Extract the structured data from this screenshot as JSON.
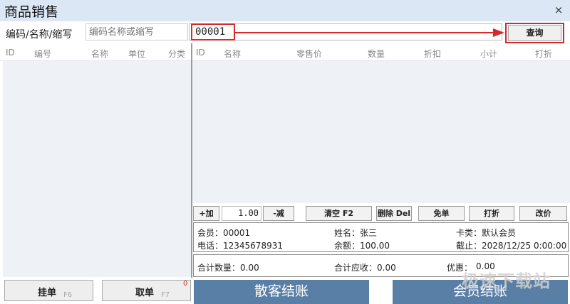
{
  "window": {
    "title": "商品销售",
    "close_glyph": "×"
  },
  "search": {
    "label": "编码/名称/缩写",
    "placeholder": "编码名称或缩写",
    "code_value": "00001",
    "query_label": "查询"
  },
  "product_table": {
    "headers": [
      "ID",
      "编号",
      "名称",
      "单位",
      "分类"
    ]
  },
  "cart_table": {
    "headers": [
      "ID",
      "名称",
      "零售价",
      "数量",
      "折扣",
      "小计",
      "打折"
    ]
  },
  "controls": {
    "add_label": "+加",
    "quantity": "1.00",
    "subtract_label": "-减",
    "clear_label": "清空 F2",
    "delete_label": "删除 Del",
    "free_label": "免单",
    "discount_label": "打折",
    "change_price_label": "改价"
  },
  "member": {
    "id_label": "会员：00001",
    "name_label": "姓名：张三",
    "card_label": "卡类：默认会员",
    "phone_label": "电话：12345678931",
    "balance_label": "余额：100.00",
    "expiry_label": "截止：2028/12/25 0:00:00"
  },
  "totals": {
    "quantity_label": "合计数量：0.00",
    "due_label": "合计应收：0.00",
    "discount_label": "优惠：",
    "discount_value": "0.00"
  },
  "bottom": {
    "hold_label": "挂单",
    "hold_key": "F6",
    "retrieve_label": "取单",
    "retrieve_key": "F7",
    "retrieve_count": "0",
    "walkin_checkout": "散客结账",
    "member_checkout": "会员结账"
  },
  "watermark": "极速下载站",
  "colors": {
    "accent_red": "#d62a2a",
    "checkout_blue": "#5a7fa6",
    "panel_bg": "#eef2f7",
    "titlebar": "#dbe7f5"
  }
}
